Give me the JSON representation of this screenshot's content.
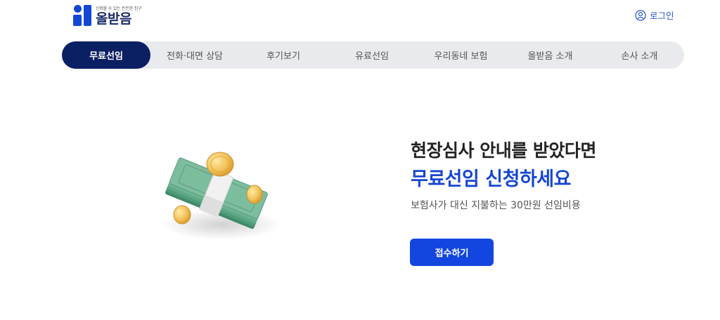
{
  "header": {
    "logo_tagline": "신뢰할 수 있는 든든한 친구",
    "logo_name": "올받음",
    "login_label": "로그인"
  },
  "nav": {
    "items": [
      {
        "label": "무료선임",
        "active": true
      },
      {
        "label": "전화·대면 상담",
        "active": false
      },
      {
        "label": "후기보기",
        "active": false
      },
      {
        "label": "유료선임",
        "active": false
      },
      {
        "label": "우리동네 보험",
        "active": false
      },
      {
        "label": "올받음 소개",
        "active": false
      },
      {
        "label": "손사 소개",
        "active": false
      }
    ]
  },
  "hero": {
    "title": "현장심사 안내를 받았다면",
    "highlight": "무료선임 신청하세요",
    "subtitle": "보험사가 대신 지불하는 30만원 선임비용",
    "cta_label": "접수하기",
    "illustration": "money-stack-with-coins"
  },
  "colors": {
    "brand": "#1446d6",
    "nav_active": "#0b1f63",
    "nav_bg": "#e9eaed",
    "cta": "#1346e0",
    "highlight": "#1546d2"
  }
}
